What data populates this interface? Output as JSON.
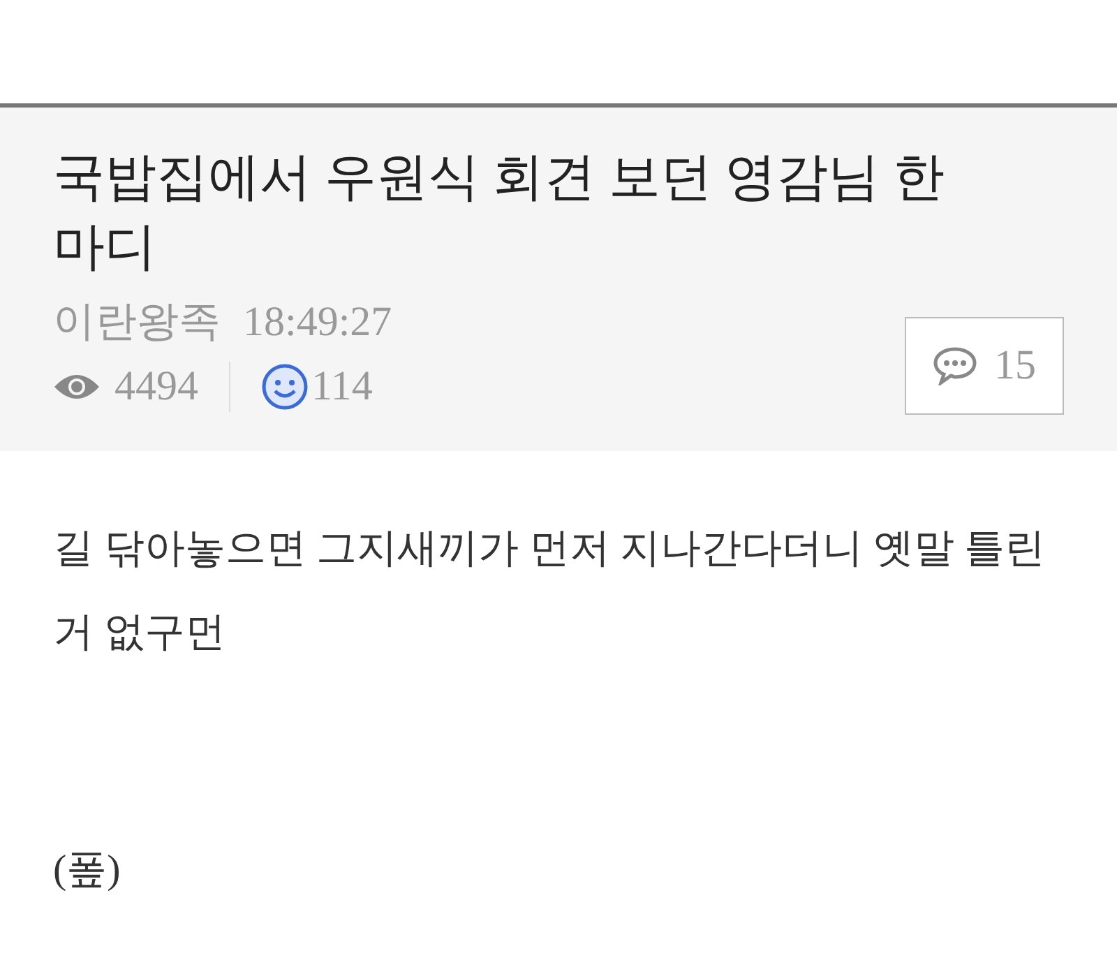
{
  "post": {
    "title": "국밥집에서 우원식 회견 보던 영감님 한마디",
    "author": "이란왕족",
    "time": "18:49:27",
    "views": "4494",
    "likes": "114",
    "comments": "15"
  },
  "body": [
    "길 닦아놓으면 그지새끼가 먼저 지나간다더니 옛말 틀린거 없구먼",
    "(퐆)"
  ]
}
